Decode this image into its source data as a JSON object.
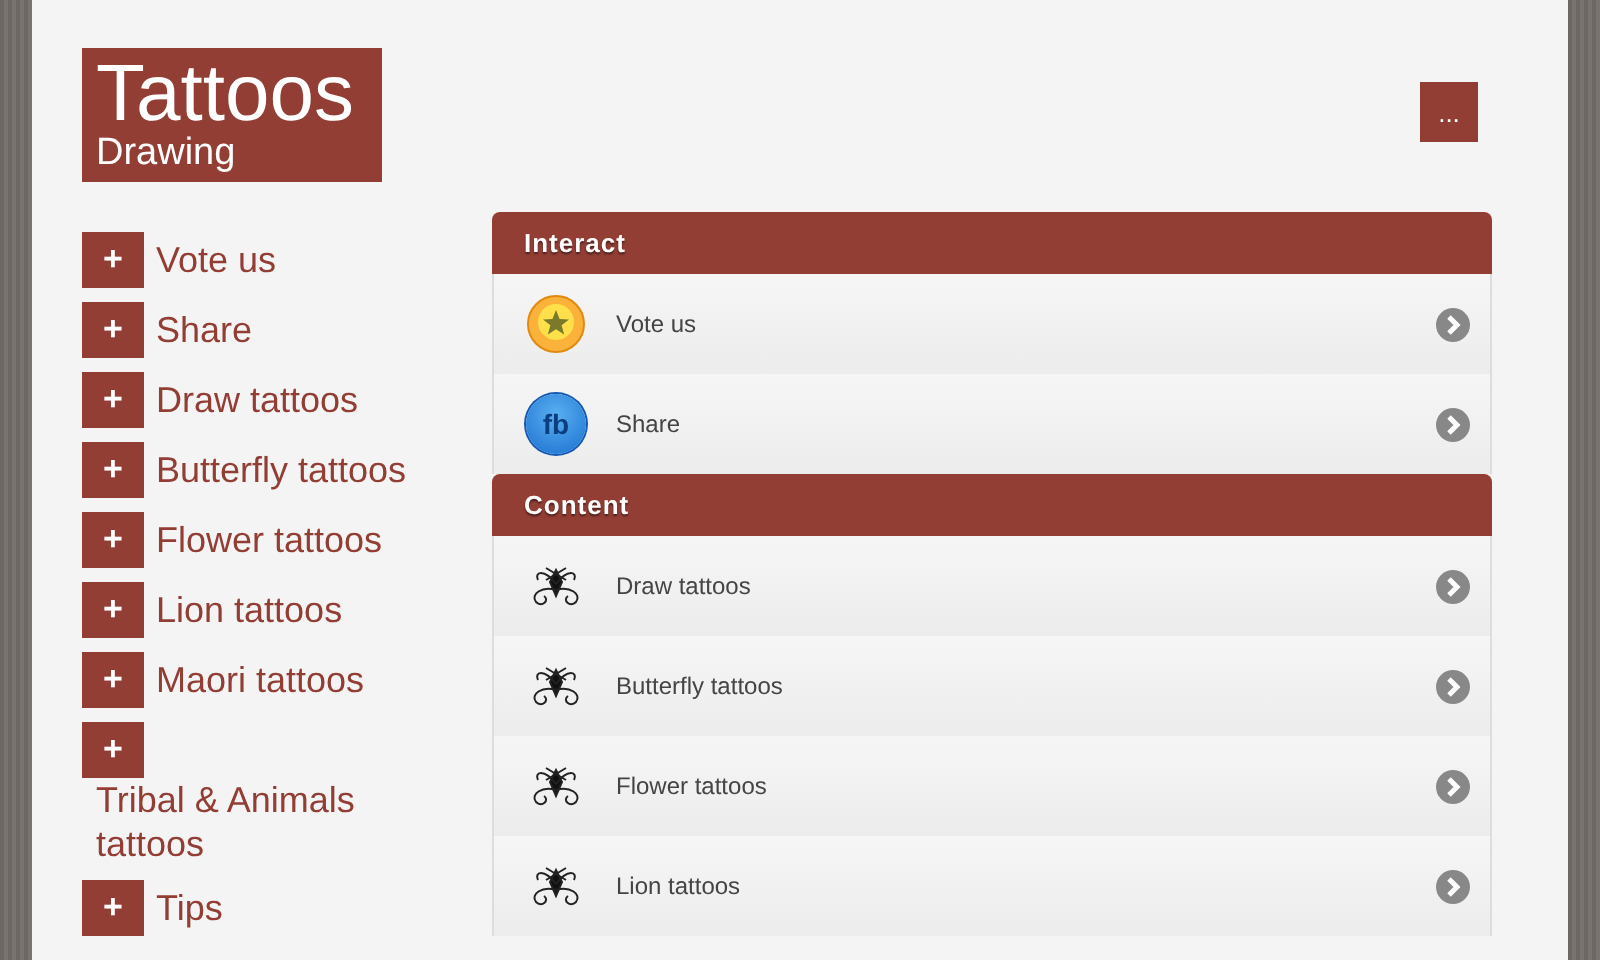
{
  "logo": {
    "title": "Tattoos",
    "subtitle": "Drawing"
  },
  "menu_button": "...",
  "nav": [
    {
      "icon": "+",
      "label": "Vote us"
    },
    {
      "icon": "+",
      "label": "Share"
    },
    {
      "icon": "+",
      "label": "Draw tattoos"
    },
    {
      "icon": "+",
      "label": "Butterfly tattoos"
    },
    {
      "icon": "+",
      "label": "Flower tattoos"
    },
    {
      "icon": "+",
      "label": "Lion tattoos"
    },
    {
      "icon": "+",
      "label": "Maori tattoos"
    },
    {
      "icon": "+",
      "label": "Tribal & Animals tattoos"
    },
    {
      "icon": "+",
      "label": "Tips"
    }
  ],
  "sections": [
    {
      "title": "Interact",
      "items": [
        {
          "kind": "star",
          "label": "Vote us"
        },
        {
          "kind": "facebook",
          "label": "Share",
          "icon_text": "fb"
        }
      ]
    },
    {
      "title": "Content",
      "items": [
        {
          "kind": "tattoo",
          "label": "Draw tattoos"
        },
        {
          "kind": "tattoo",
          "label": "Butterfly tattoos"
        },
        {
          "kind": "tattoo",
          "label": "Flower tattoos"
        },
        {
          "kind": "tattoo",
          "label": "Lion tattoos"
        }
      ]
    }
  ]
}
